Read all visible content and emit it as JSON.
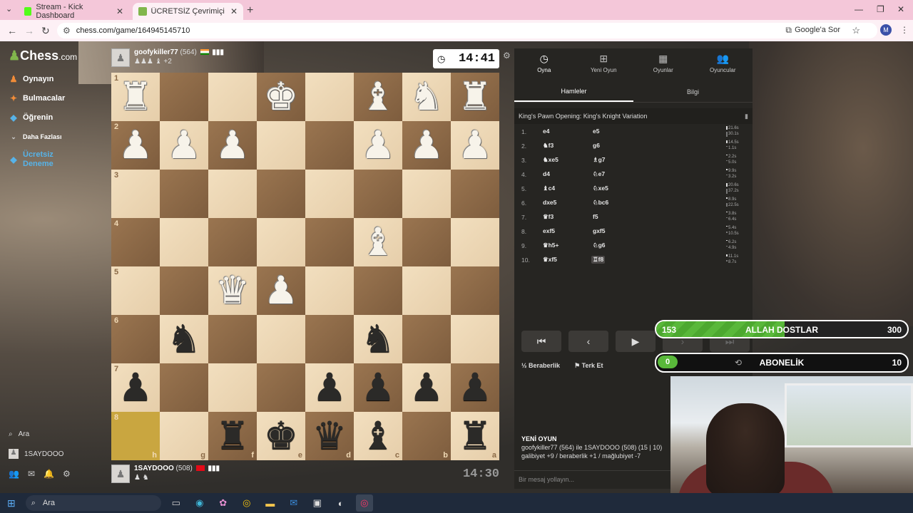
{
  "browser": {
    "tabs": [
      {
        "label": "Stream - Kick Dashboard",
        "active": false,
        "favicon_color": "#53fc18"
      },
      {
        "label": "ÜCRETSİZ Çevrimiçi Satranç Oy",
        "active": true,
        "favicon_color": "#81b64c"
      }
    ],
    "url": "chess.com/game/164945145710",
    "google_ask": "Google'a Sor",
    "avatar_letter": "M"
  },
  "sidebar": {
    "logo_main": "Chess",
    "logo_suffix": ".com",
    "items": [
      {
        "label": "Oynayın",
        "icon": "play-icon",
        "color": "#f28c38"
      },
      {
        "label": "Bulmacalar",
        "icon": "puzzle-icon",
        "color": "#f28c38"
      },
      {
        "label": "Öğrenin",
        "icon": "learn-icon",
        "color": "#57b3e8"
      },
      {
        "label": "Daha Fazlası",
        "icon": "chevron-down-icon",
        "color": "#ccc"
      },
      {
        "label": "Ücretsiz Deneme",
        "icon": "diamond-icon",
        "color": "#57b3e8"
      }
    ],
    "search_label": "Ara",
    "user_label": "1SAYDOOO"
  },
  "top_player": {
    "name": "goofykiller77",
    "rating": "(564)",
    "flag": "IN",
    "captured": "♟♟♟ ♝ +2",
    "clock": "14:41"
  },
  "bottom_player": {
    "name": "1SAYDOOO",
    "rating": "(508)",
    "flag": "TR",
    "captured": "♟ ♞",
    "clock": "14:30"
  },
  "board": {
    "ranks": [
      "1",
      "2",
      "3",
      "4",
      "5",
      "6",
      "7",
      "8"
    ],
    "files": [
      "h",
      "g",
      "f",
      "e",
      "d",
      "c",
      "b",
      "a"
    ],
    "highlight": [
      "h8"
    ],
    "pieces": {
      "h1": "♜w",
      "e1": "♚w",
      "c1": "♝w",
      "b1": "♞w",
      "a1": "♜w",
      "h2": "♟w",
      "g2": "♟w",
      "f2": "♟w",
      "c2": "♟w",
      "b2": "♟w",
      "a2": "♟w",
      "c4": "♝w",
      "f5": "♛w",
      "e5": "♟w",
      "g6": "♞b",
      "c6": "♞b",
      "h7": "♟b",
      "d7": "♟b",
      "c7": "♟b",
      "b7": "♟b",
      "a7": "♟b",
      "f8": "♜b",
      "e8": "♚b",
      "d8": "♛b",
      "c8": "♝b",
      "a8": "♜b"
    }
  },
  "panel": {
    "tabs": [
      {
        "label": "Oyna",
        "icon": "clock-icon",
        "active": true
      },
      {
        "label": "Yeni Oyun",
        "icon": "plus-icon",
        "active": false
      },
      {
        "label": "Oyunlar",
        "icon": "board-icon",
        "active": false
      },
      {
        "label": "Oyuncular",
        "icon": "players-icon",
        "active": false
      }
    ],
    "subtabs": [
      {
        "label": "Hamleler",
        "active": true
      },
      {
        "label": "Bilgi",
        "active": false
      }
    ],
    "opening": "King's Pawn Opening: King's Knight Variation",
    "moves": [
      {
        "n": "1.",
        "w": "e4",
        "b": "e5",
        "tw": "21.6s",
        "tb": "30.1s",
        "bw": 0.7,
        "bb": 1.0
      },
      {
        "n": "2.",
        "w": "♞f3",
        "b": "g6",
        "tw": "14.5s",
        "tb": "1.1s",
        "bw": 0.5,
        "bb": 0.1
      },
      {
        "n": "3.",
        "w": "♞xe5",
        "b": "♗g7",
        "tw": "2.2s",
        "tb": "5.0s",
        "bw": 0.1,
        "bb": 0.2
      },
      {
        "n": "4.",
        "w": "d4",
        "b": "♘e7",
        "tw": "9.9s",
        "tb": "3.2s",
        "bw": 0.3,
        "bb": 0.1
      },
      {
        "n": "5.",
        "w": "♝c4",
        "b": "♘xe5",
        "tw": "20.6s",
        "tb": "37.2s",
        "bw": 0.7,
        "bb": 1.0
      },
      {
        "n": "6.",
        "w": "dxe5",
        "b": "♘bc6",
        "tw": "8.9s",
        "tb": "22.5s",
        "bw": 0.3,
        "bb": 0.7
      },
      {
        "n": "7.",
        "w": "♛f3",
        "b": "f5",
        "tw": "3.8s",
        "tb": "6.4s",
        "bw": 0.1,
        "bb": 0.2
      },
      {
        "n": "8.",
        "w": "exf5",
        "b": "gxf5",
        "tw": "5.4s",
        "tb": "10.5s",
        "bw": 0.2,
        "bb": 0.3
      },
      {
        "n": "9.",
        "w": "♛h5+",
        "b": "♘g6",
        "tw": "6.2s",
        "tb": "4.9s",
        "bw": 0.2,
        "bb": 0.2
      },
      {
        "n": "10.",
        "w": "♛xf5",
        "b": "♖f8",
        "tw": "11.1s",
        "tb": "8.7s",
        "bw": 0.4,
        "bb": 0.3
      }
    ],
    "draw_label": "Beraberlik",
    "resign_label": "Terk Et",
    "new_game_title": "YENİ OYUN",
    "new_game_line1": "goofykiller77 (564) ile 1SAYDOOO (508) (15 | 10)",
    "new_game_line2": "galibiyet +9 / beraberlik +1 / mağlubiyet -7",
    "chat_placeholder": "Bir mesaj yollayın..."
  },
  "overlays": {
    "goal1": {
      "left": "153",
      "title": "ALLAH DOSTLAR",
      "right": "300",
      "progress": 0.51
    },
    "goal2": {
      "left": "0",
      "title": "ABONELİK",
      "right": "10",
      "progress": 0.0
    }
  },
  "taskbar": {
    "search_label": "Ara"
  }
}
